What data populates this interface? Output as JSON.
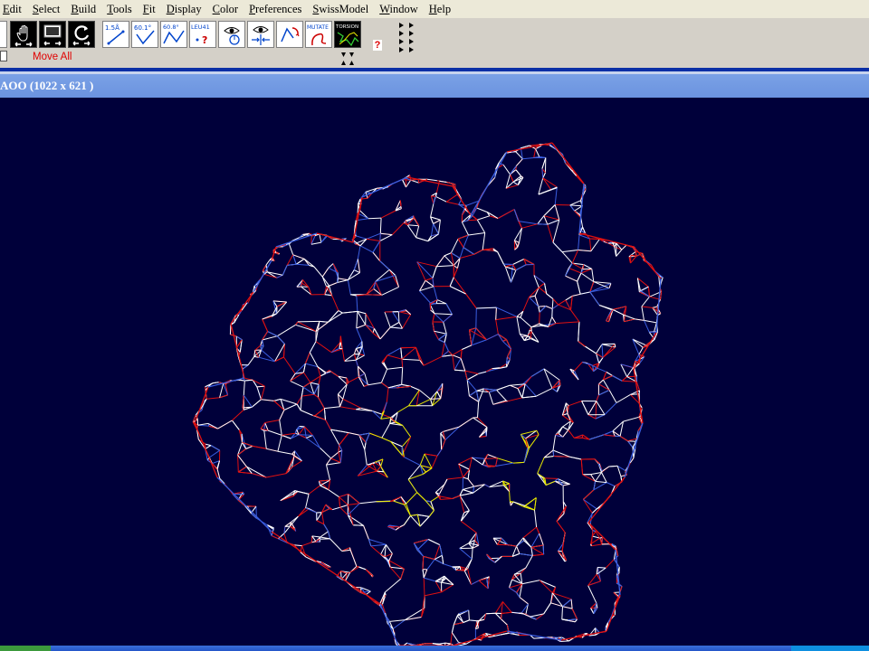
{
  "menu": [
    {
      "label": "Edit",
      "key": "E",
      "rest": "dit"
    },
    {
      "label": "Select",
      "key": "S",
      "rest": "elect"
    },
    {
      "label": "Build",
      "key": "B",
      "rest": "uild"
    },
    {
      "label": "Tools",
      "key": "T",
      "rest": "ools"
    },
    {
      "label": "Fit",
      "key": "F",
      "rest": "it"
    },
    {
      "label": "Display",
      "key": "D",
      "rest": "isplay"
    },
    {
      "label": "Color",
      "key": "C",
      "rest": "olor"
    },
    {
      "label": "Preferences",
      "key": "P",
      "rest": "references"
    },
    {
      "label": "SwissModel",
      "key": "S",
      "rest": "wissModel"
    },
    {
      "label": "Window",
      "key": "W",
      "rest": "indow"
    },
    {
      "label": "Help",
      "key": "H",
      "rest": "elp"
    }
  ],
  "toolbar": {
    "mode_label": "Move All",
    "tools": {
      "distance": "1.5Å",
      "angle": "60.1°",
      "dihedral": "60.8°",
      "label_residue": "LEU41",
      "mutate": "MUTATE",
      "torsion": "TORSION",
      "help": "?"
    }
  },
  "window": {
    "title": "AOO   (1022 x 621 )"
  },
  "colors": {
    "viewport_bg": "#00003a",
    "mesh_white": "#ffffff",
    "mesh_red": "#e01010",
    "mesh_blue": "#3a5ee0",
    "mesh_yellow": "#e8e800",
    "titlebar": "#7aa1e6"
  }
}
